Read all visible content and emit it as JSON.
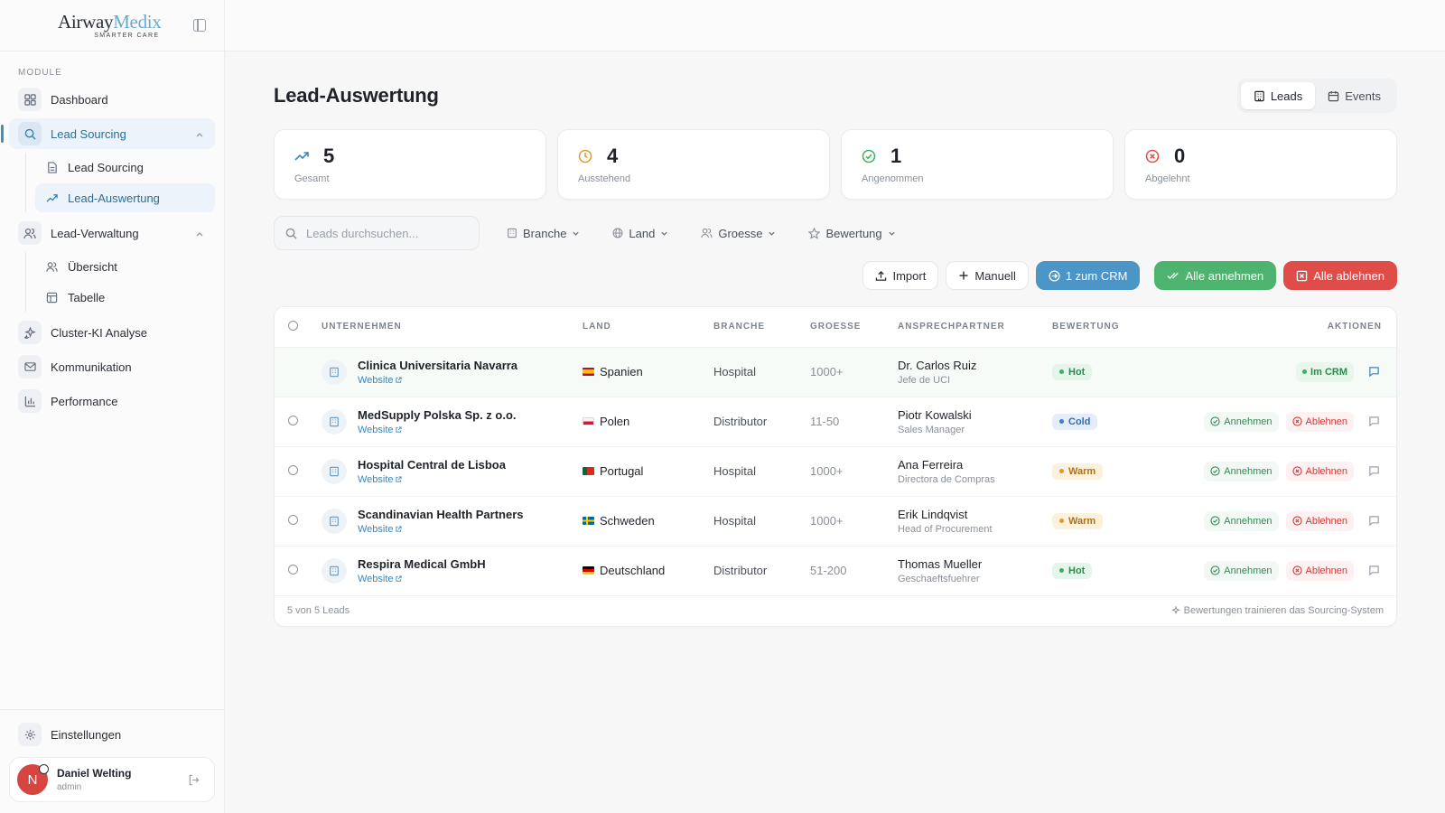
{
  "brand": {
    "name_part1": "Airway",
    "name_part2": "Medix",
    "tagline": "SMARTER CARE"
  },
  "sidebar": {
    "section_label": "MODULE",
    "items": [
      {
        "label": "Dashboard"
      },
      {
        "label": "Lead Sourcing",
        "sub": [
          {
            "label": "Lead Sourcing"
          },
          {
            "label": "Lead-Auswertung"
          }
        ]
      },
      {
        "label": "Lead-Verwaltung",
        "sub": [
          {
            "label": "Übersicht"
          },
          {
            "label": "Tabelle"
          }
        ]
      },
      {
        "label": "Cluster-KI Analyse"
      },
      {
        "label": "Kommunikation"
      },
      {
        "label": "Performance"
      }
    ],
    "settings_label": "Einstellungen",
    "user": {
      "initial": "N",
      "name": "Daniel Welting",
      "role": "admin"
    }
  },
  "page": {
    "title": "Lead-Auswertung",
    "toggle": {
      "leads": "Leads",
      "events": "Events"
    }
  },
  "stats": [
    {
      "value": "5",
      "label": "Gesamt"
    },
    {
      "value": "4",
      "label": "Ausstehend"
    },
    {
      "value": "1",
      "label": "Angenommen"
    },
    {
      "value": "0",
      "label": "Abgelehnt"
    }
  ],
  "filters": {
    "search_placeholder": "Leads durchsuchen...",
    "branche": "Branche",
    "land": "Land",
    "groesse": "Groesse",
    "bewertung": "Bewertung"
  },
  "actions": {
    "import": "Import",
    "manual": "Manuell",
    "to_crm": "1 zum CRM",
    "accept_all": "Alle annehmen",
    "reject_all": "Alle ablehnen"
  },
  "table": {
    "headers": {
      "company": "UNTERNEHMEN",
      "country": "LAND",
      "industry": "BRANCHE",
      "size": "GROESSE",
      "contact": "ANSPRECHPARTNER",
      "rating": "BEWERTUNG",
      "actions": "AKTIONEN"
    },
    "website_label": "Website",
    "accept_label": "Annehmen",
    "reject_label": "Ablehnen",
    "in_crm_label": "Im CRM",
    "rows": [
      {
        "company": "Clinica Universitaria Navarra",
        "country": "Spanien",
        "industry": "Hospital",
        "size": "1000+",
        "contact": "Dr. Carlos Ruiz",
        "role": "Jefe de UCI",
        "rating": "Hot"
      },
      {
        "company": "MedSupply Polska Sp. z o.o.",
        "country": "Polen",
        "industry": "Distributor",
        "size": "11-50",
        "contact": "Piotr Kowalski",
        "role": "Sales Manager",
        "rating": "Cold"
      },
      {
        "company": "Hospital Central de Lisboa",
        "country": "Portugal",
        "industry": "Hospital",
        "size": "1000+",
        "contact": "Ana Ferreira",
        "role": "Directora de Compras",
        "rating": "Warm"
      },
      {
        "company": "Scandinavian Health Partners",
        "country": "Schweden",
        "industry": "Hospital",
        "size": "1000+",
        "contact": "Erik Lindqvist",
        "role": "Head of Procurement",
        "rating": "Warm"
      },
      {
        "company": "Respira Medical GmbH",
        "country": "Deutschland",
        "industry": "Distributor",
        "size": "51-200",
        "contact": "Thomas Mueller",
        "role": "Geschaeftsfuehrer",
        "rating": "Hot"
      }
    ],
    "footer_count": "5 von 5 Leads",
    "footer_note": "Bewertungen trainieren das Sourcing-System"
  },
  "colors": {
    "accent": "#4b96c6",
    "success": "#4fb370",
    "danger": "#df4d4a",
    "warning": "#e09a2a"
  }
}
